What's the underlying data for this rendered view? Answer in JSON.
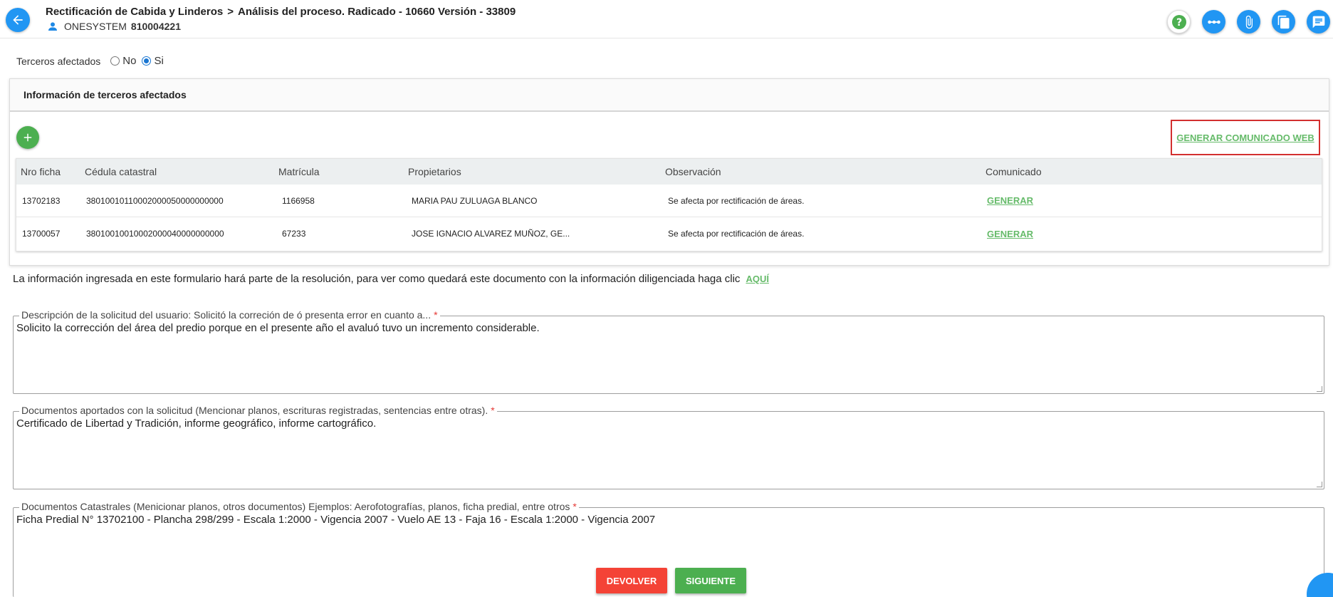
{
  "header": {
    "process": "Rectificación de Cabida y Linderos",
    "step": "Análisis del proceso. Radicado - 10660 Versión - 33809",
    "user_name": "ONESYSTEM",
    "user_id": "810004221",
    "icons": [
      "help-icon",
      "dots-icon",
      "attachment-icon",
      "copy-icon",
      "comments-icon"
    ]
  },
  "terceros": {
    "label": "Terceros afectados",
    "options": [
      "No",
      "Si"
    ],
    "selected": "Si"
  },
  "panel": {
    "title": "Información de terceros afectados",
    "generate_web_label": "GENERAR COMUNICADO WEB",
    "columns": [
      "Nro ficha",
      "Cédula catastral",
      "Matrícula",
      "Propietarios",
      "Observación",
      "Comunicado"
    ],
    "rows": [
      {
        "ficha": "13702183",
        "cedula": "38010010110002000050000000000",
        "matricula": "1166958",
        "propietarios": "MARIA PAU ZULUAGA BLANCO",
        "observacion": "Se afecta por rectificación de áreas.",
        "comunicado": "GENERAR"
      },
      {
        "ficha": "13700057",
        "cedula": "38010010010002000040000000000",
        "matricula": "67233",
        "propietarios": "JOSE IGNACIO ALVAREZ MUÑOZ, GE...",
        "observacion": "Se afecta por rectificación de áreas.",
        "comunicado": "GENERAR"
      }
    ]
  },
  "info": {
    "text": "La información ingresada en este formulario hará parte de la resolución, para ver como quedará este documento con la información diligenciada haga clic",
    "link": "AQUÍ"
  },
  "fields": {
    "descripcion": {
      "label": "Descripción de la solicitud del usuario: Solicitó la correción de ó presenta error en cuanto a...",
      "value": "Solicito la corrección del área del predio porque en el presente año el avaluó tuvo un incremento considerable.",
      "required_mark": "*"
    },
    "documentos": {
      "label": "Documentos aportados con la solicitud (Mencionar planos, escrituras registradas, sentencias entre otras).",
      "value": "Certificado de Libertad y Tradición, informe geográfico, informe cartográfico.",
      "required_mark": "*"
    },
    "catastrales": {
      "label": "Documentos Catastrales (Menicionar planos, otros documentos) Ejemplos: Aerofotografías, planos, ficha predial, entre otros",
      "value": "Ficha Predial N° 13702100 - Plancha 298/299 - Escala 1:2000 - Vigencia 2007 - Vuelo AE 13 - Faja 16 - Escala 1:2000 - Vigencia 2007",
      "required_mark": "*"
    }
  },
  "buttons": {
    "devolver": "DEVOLVER",
    "siguiente": "SIGUIENTE"
  }
}
